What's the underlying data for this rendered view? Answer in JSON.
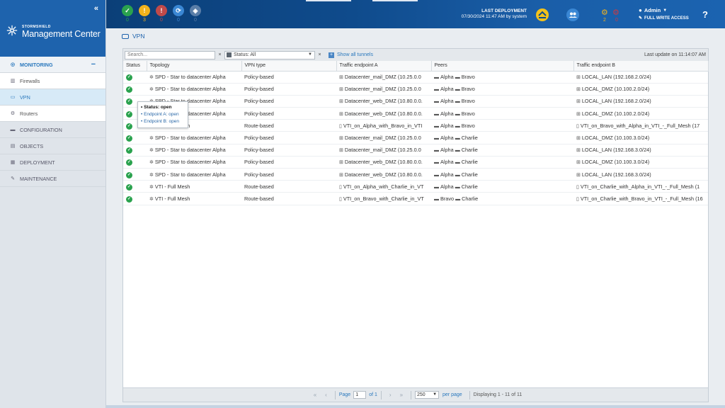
{
  "header": {
    "status": [
      {
        "icon": "check-icon",
        "count": "0",
        "color": "#2aa24e",
        "glyph": "✓"
      },
      {
        "icon": "warning-icon",
        "count": "3",
        "color": "#f3b21b",
        "glyph": "!"
      },
      {
        "icon": "error-icon",
        "count": "0",
        "color": "#c04a4a",
        "glyph": "!"
      },
      {
        "icon": "sync-icon",
        "count": "0",
        "color": "#3a87d4",
        "glyph": "⟳"
      },
      {
        "icon": "shield-icon",
        "count": "0",
        "color": "#5a7ea8",
        "glyph": "◈"
      }
    ],
    "last_deployment_title": "LAST DEPLOYMENT",
    "last_deployment_value": "07/30/2024 11:47 AM by system",
    "gear_counts": {
      "yellow": "2",
      "red": "0"
    },
    "admin_name": "Admin",
    "access": "FULL WRITE ACCESS",
    "help": "?"
  },
  "brand": {
    "line1": "STORMSHIELD",
    "line2": "Management Center",
    "collapse": "«"
  },
  "nav": {
    "monitoring": "MONITORING",
    "monitoring_toggle": "−",
    "firewalls": "Firewalls",
    "vpn": "VPN",
    "routers": "Routers",
    "configuration": "CONFIGURATION",
    "objects": "OBJECTS",
    "deployment": "DEPLOYMENT",
    "maintenance": "MAINTENANCE"
  },
  "page": {
    "title": "VPN"
  },
  "toolbar": {
    "search_placeholder": "Search...",
    "clear": "×",
    "status_filter": "Status: All",
    "show_all": "Show all tunnels",
    "last_update": "Last update on 11:14:07 AM"
  },
  "table": {
    "columns": [
      "Status",
      "Topology",
      "VPN type",
      "Traffic endpoint A",
      "Peers",
      "Traffic endpoint B"
    ],
    "rows": [
      {
        "topology": "SPD - Star to datacenter Alpha",
        "type": "Policy-based",
        "a": "Datacenter_mail_DMZ (10.25.0.0",
        "peer1": "Alpha",
        "peer2": "Bravo",
        "b": "LOCAL_LAN (192.168.2.0/24)"
      },
      {
        "topology": "SPD - Star to datacenter Alpha",
        "type": "Policy-based",
        "a": "Datacenter_mail_DMZ (10.25.0.0",
        "peer1": "Alpha",
        "peer2": "Bravo",
        "b": "LOCAL_DMZ (10.100.2.0/24)"
      },
      {
        "topology": "SPD - Star to datacenter Alpha",
        "type": "Policy-based",
        "a": "Datacenter_web_DMZ (10.80.0.0.",
        "peer1": "Alpha",
        "peer2": "Bravo",
        "b": "LOCAL_LAN (192.168.2.0/24)"
      },
      {
        "topology": "SPD - Star to datacenter Alpha",
        "type": "Policy-based",
        "a": "Datacenter_web_DMZ (10.80.0.0.",
        "peer1": "Alpha",
        "peer2": "Bravo",
        "b": "LOCAL_DMZ (10.100.2.0/24)"
      },
      {
        "topology": "VTI - Full Mesh",
        "type": "Route-based",
        "a": "VTI_on_Alpha_with_Bravo_in_VTI",
        "peer1": "Alpha",
        "peer2": "Bravo",
        "b": "VTI_on_Bravo_with_Alpha_in_VTI_-_Full_Mesh (17"
      },
      {
        "topology": "SPD - Star to datacenter Alpha",
        "type": "Policy-based",
        "a": "Datacenter_mail_DMZ (10.25.0.0",
        "peer1": "Alpha",
        "peer2": "Charlie",
        "b": "LOCAL_DMZ (10.100.3.0/24)"
      },
      {
        "topology": "SPD - Star to datacenter Alpha",
        "type": "Policy-based",
        "a": "Datacenter_mail_DMZ (10.25.0.0",
        "peer1": "Alpha",
        "peer2": "Charlie",
        "b": "LOCAL_LAN (192.168.3.0/24)"
      },
      {
        "topology": "SPD - Star to datacenter Alpha",
        "type": "Policy-based",
        "a": "Datacenter_web_DMZ (10.80.0.0.",
        "peer1": "Alpha",
        "peer2": "Charlie",
        "b": "LOCAL_DMZ (10.100.3.0/24)"
      },
      {
        "topology": "SPD - Star to datacenter Alpha",
        "type": "Policy-based",
        "a": "Datacenter_web_DMZ (10.80.0.0.",
        "peer1": "Alpha",
        "peer2": "Charlie",
        "b": "LOCAL_LAN (192.168.3.0/24)"
      },
      {
        "topology": "VTI - Full Mesh",
        "type": "Route-based",
        "a": "VTI_on_Alpha_with_Charlie_in_VT",
        "peer1": "Alpha",
        "peer2": "Charlie",
        "b": "VTI_on_Charlie_with_Alpha_in_VTI_-_Full_Mesh (1"
      },
      {
        "topology": "VTI - Full Mesh",
        "type": "Route-based",
        "a": "VTI_on_Bravo_with_Charlie_in_VT",
        "peer1": "Bravo",
        "peer2": "Charlie",
        "b": "VTI_on_Charlie_with_Bravo_in_VTI_-_Full_Mesh (16"
      }
    ]
  },
  "tooltip": {
    "title": "Status: open",
    "line1": "Endpoint A: open",
    "line2": "Endpoint B: open"
  },
  "pager": {
    "page_label": "Page",
    "page_value": "1",
    "of": "of 1",
    "per_page_value": "250",
    "per_page_label": "per page",
    "display": "Displaying 1 - 11 of 11"
  }
}
